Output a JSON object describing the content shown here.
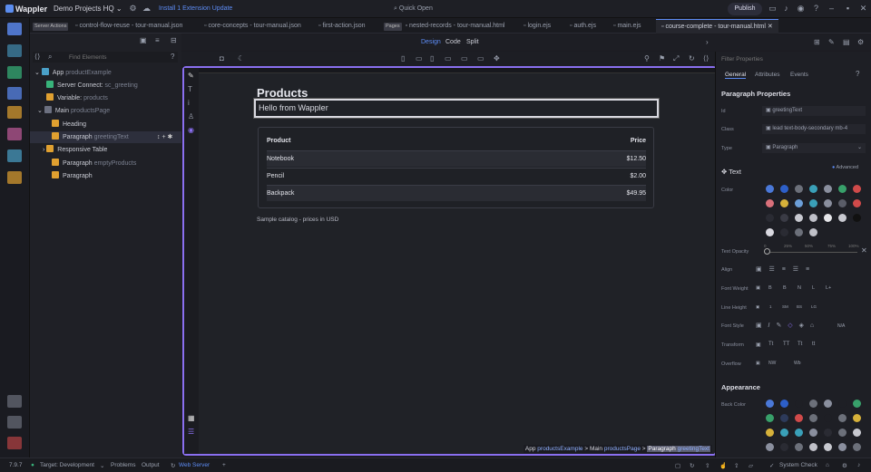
{
  "app": {
    "name": "Wappler",
    "project": "Demo Projects HQ",
    "update_notice": "Install 1 Extension Update",
    "quick_open": "Quick Open",
    "publish": "Publish"
  },
  "tabs": [
    {
      "tag": "Server Actions",
      "label": ""
    },
    {
      "tag": "",
      "label": "control-flow-reuse - tour-manual.json"
    },
    {
      "tag": "",
      "label": "core-concepts - tour-manual.json"
    },
    {
      "tag": "",
      "label": "first-action.json"
    },
    {
      "tag": "Pages",
      "label": "nested-records - tour-manual.html"
    },
    {
      "tag": "",
      "label": "login.ejs"
    },
    {
      "tag": "",
      "label": "auth.ejs"
    },
    {
      "tag": "",
      "label": "main.ejs"
    },
    {
      "tag": "",
      "label": "course-complete - tour-manual.html"
    }
  ],
  "view_modes": {
    "design": "Design",
    "code": "Code",
    "split": "Split"
  },
  "tree": {
    "search_placeholder": "Find Elements",
    "items": [
      {
        "label": "App",
        "name": "productExample"
      },
      {
        "label": "Server Connect:",
        "name": "sc_greeting"
      },
      {
        "label": "Variable:",
        "name": "products"
      },
      {
        "label": "Main",
        "name": "productsPage"
      },
      {
        "label": "Heading",
        "name": ""
      },
      {
        "label": "Paragraph",
        "name": "greetingText"
      },
      {
        "label": "Responsive Table",
        "name": ""
      },
      {
        "label": "Paragraph",
        "name": "emptyProducts"
      },
      {
        "label": "Paragraph",
        "name": ""
      }
    ]
  },
  "page": {
    "title": "Products",
    "greeting": "Hello from Wappler",
    "table": {
      "headers": [
        "Product",
        "Price"
      ],
      "rows": [
        [
          "Notebook",
          "$12.50"
        ],
        [
          "Pencil",
          "$2.00"
        ],
        [
          "Backpack",
          "$49.95"
        ]
      ]
    },
    "caption": "Sample catalog - prices in USD"
  },
  "breadcrumb": {
    "a": "App",
    "a_name": "productsExample",
    "b": "Main",
    "b_name": "productsPage",
    "c": "Paragraph",
    "c_name": "greetingText",
    "sep": ">"
  },
  "properties": {
    "tabs": [
      "General",
      "Attributes",
      "Events"
    ],
    "filter_placeholder": "Filter Properties",
    "section": "Paragraph Properties",
    "id_label": "Id",
    "id_value": "greetingText",
    "class_label": "Class",
    "class_value": "lead text-body-secondary mb-4",
    "type_label": "Type",
    "type_value": "Paragraph",
    "text_section": "Text",
    "advanced": "Advanced",
    "color_label": "Color",
    "opacity_label": "Text Opacity",
    "opacity_ticks": [
      "0",
      "25%",
      "50%",
      "75%",
      "100%"
    ],
    "align_label": "Align",
    "weight_label": "Font Weight",
    "weights": [
      "B",
      "B",
      "N",
      "L",
      "L+"
    ],
    "lineheight_label": "Line Height",
    "lineheights": [
      "1",
      "SM",
      "BS",
      "LG"
    ],
    "fontstyle_label": "Font Style",
    "fontstyle_na": "N/A",
    "transform_label": "Transform",
    "transforms": [
      "Tt",
      "TT",
      "Tt",
      "tt"
    ],
    "overflow_label": "Overflow",
    "overflows": [
      "NW",
      "Wb"
    ],
    "appearance_section": "Appearance",
    "backcolor_label": "Back Color"
  },
  "status": {
    "version": "7.9.7",
    "target": "Target: Development",
    "problems": "Problems",
    "output": "Output",
    "webserver": "Web Server",
    "syscheck": "System Check"
  },
  "colors": {
    "accent": "#5d8cf5",
    "canvas_border": "#8a6ff0",
    "bg": "#1c1c22"
  }
}
